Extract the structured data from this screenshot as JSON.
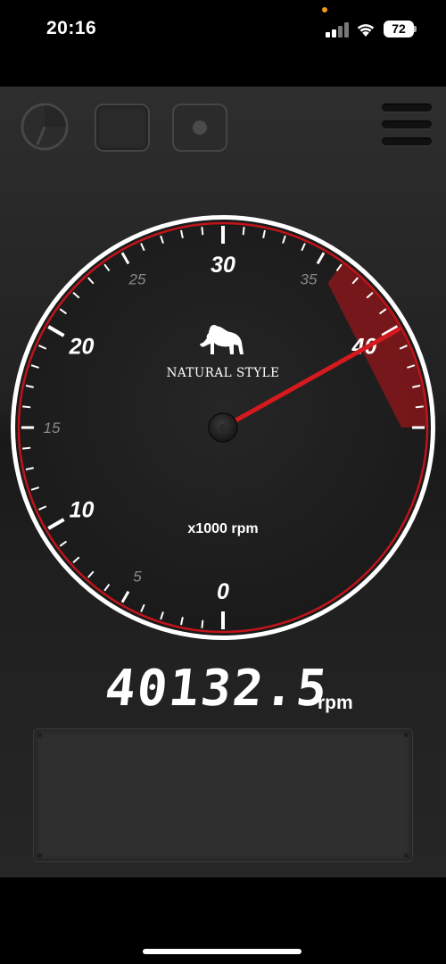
{
  "status_bar": {
    "time": "20:16",
    "battery": "72"
  },
  "toolbar": {
    "gauge_icon": "gauge-icon",
    "square_icon": "square-icon",
    "record_icon": "record-icon",
    "menu_icon": "menu-icon"
  },
  "gauge": {
    "brand": "NATURAL STYLE",
    "unit_label": "x1000 rpm",
    "min": 0,
    "max": 45,
    "major_labels": [
      "0",
      "10",
      "20",
      "30",
      "40"
    ],
    "minor_labels": [
      "5",
      "15",
      "25",
      "35"
    ],
    "needle_value": 40.1325,
    "redline_start": 36,
    "colors": {
      "accent": "#c0141a",
      "face": "#1e1e1e",
      "rim": "#ffffff",
      "minor_label": "#8a8a8a"
    }
  },
  "readout": {
    "value": "40132.5",
    "unit": "rpm"
  }
}
